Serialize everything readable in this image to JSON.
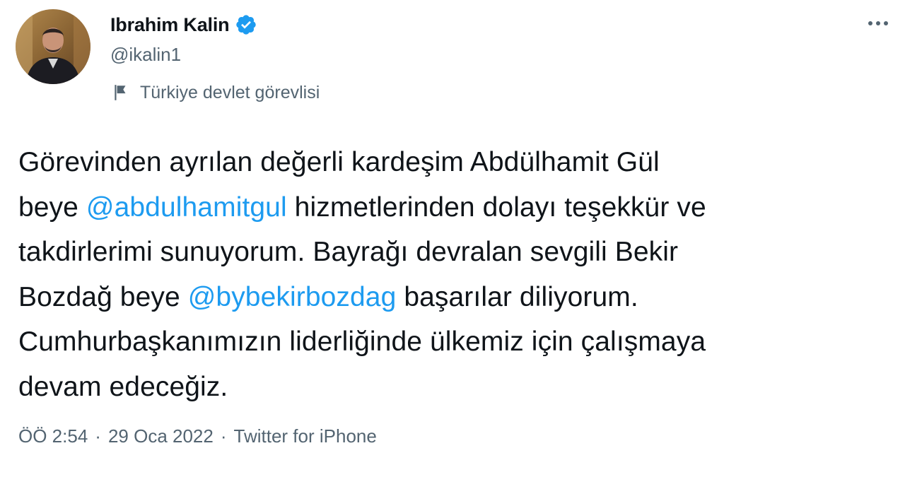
{
  "author": {
    "name": "Ibrahim Kalin",
    "handle": "@ikalin1",
    "label": "Türkiye devlet görevlisi",
    "verified": true
  },
  "tweet": {
    "lines": [
      [
        {
          "text": "Görevinden ayrılan değerli kardeşim Abdülhamit Gül"
        }
      ],
      [
        {
          "text": "beye "
        },
        {
          "text": "@abdulhamitgul",
          "mention": true
        },
        {
          "text": " hizmetlerinden dolayı teşekkür ve"
        }
      ],
      [
        {
          "text": "takdirlerimi sunuyorum. Bayrağı devralan sevgili Bekir"
        }
      ],
      [
        {
          "text": "Bozdağ beye "
        },
        {
          "text": "@bybekirbozdag",
          "mention": true
        },
        {
          "text": " başarılar diliyorum."
        }
      ],
      [
        {
          "text": "Cumhurbaşkanımızın liderliğinde ülkemiz için çalışmaya"
        }
      ],
      [
        {
          "text": "devam edeceğiz."
        }
      ]
    ]
  },
  "meta": {
    "time": "ÖÖ 2:54",
    "separator": "·",
    "date": "29 Oca 2022",
    "source": "Twitter for iPhone"
  },
  "icons": {
    "verified": "verified-badge-icon",
    "more": "more-options-icon",
    "label": "flag-icon"
  },
  "colors": {
    "text": "#0f1419",
    "secondary": "#536471",
    "link": "#1d9bf0",
    "verified": "#1d9bf0"
  }
}
